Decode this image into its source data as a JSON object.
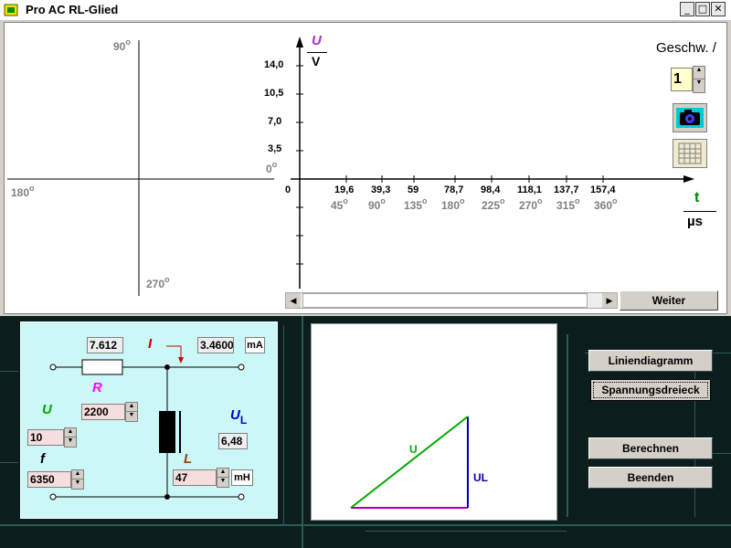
{
  "window": {
    "title": "Pro AC RL-Glied"
  },
  "titlebar_buttons": {
    "minimize": "_",
    "maximize": "□",
    "close": "✕"
  },
  "polar": {
    "label_90": "90",
    "label_180": "180",
    "label_270": "270",
    "label_0": "0",
    "deg": "o"
  },
  "graph": {
    "y_unit_top": "U",
    "y_unit_bottom": "V",
    "y_ticks": [
      "14,0",
      "10,5",
      "7,0",
      "3,5"
    ],
    "origin": "0",
    "x_ticks": [
      "19,6",
      "39,3",
      "59",
      "78,7",
      "98,4",
      "118,1",
      "137,7",
      "157,4"
    ],
    "angle_ticks": [
      "45",
      "90",
      "135",
      "180",
      "225",
      "270",
      "315",
      "360"
    ],
    "x_unit_top": "t",
    "x_unit_bottom": "µs"
  },
  "speed": {
    "label": "Geschw. /",
    "value": "1"
  },
  "buttons": {
    "weiter": "Weiter",
    "liniendiagramm": "Liniendiagramm",
    "spannungsdreieck": "Spannungsdreieck",
    "berechnen": "Berechnen",
    "beenden": "Beenden"
  },
  "circuit": {
    "current_left": "7.612",
    "current_symbol": "I",
    "current_value": "3.4600",
    "current_unit": "mA",
    "r_symbol": "R",
    "r_value": "2200",
    "u_symbol": "U",
    "u_value": "10",
    "f_symbol": "f",
    "f_value": "6350",
    "ul_symbol": "U",
    "ul_sub": "L",
    "ul_value": "6,48",
    "l_symbol": "L",
    "l_value": "47",
    "l_unit": "mH"
  },
  "vector": {
    "u_label": "U",
    "ul_label": "UL"
  },
  "colors": {
    "u": "#00aa00",
    "ul": "#0000aa",
    "ur": "#aa00aa",
    "i": "#cc0000",
    "r": "#ff00ff",
    "l": "#8b4513"
  }
}
